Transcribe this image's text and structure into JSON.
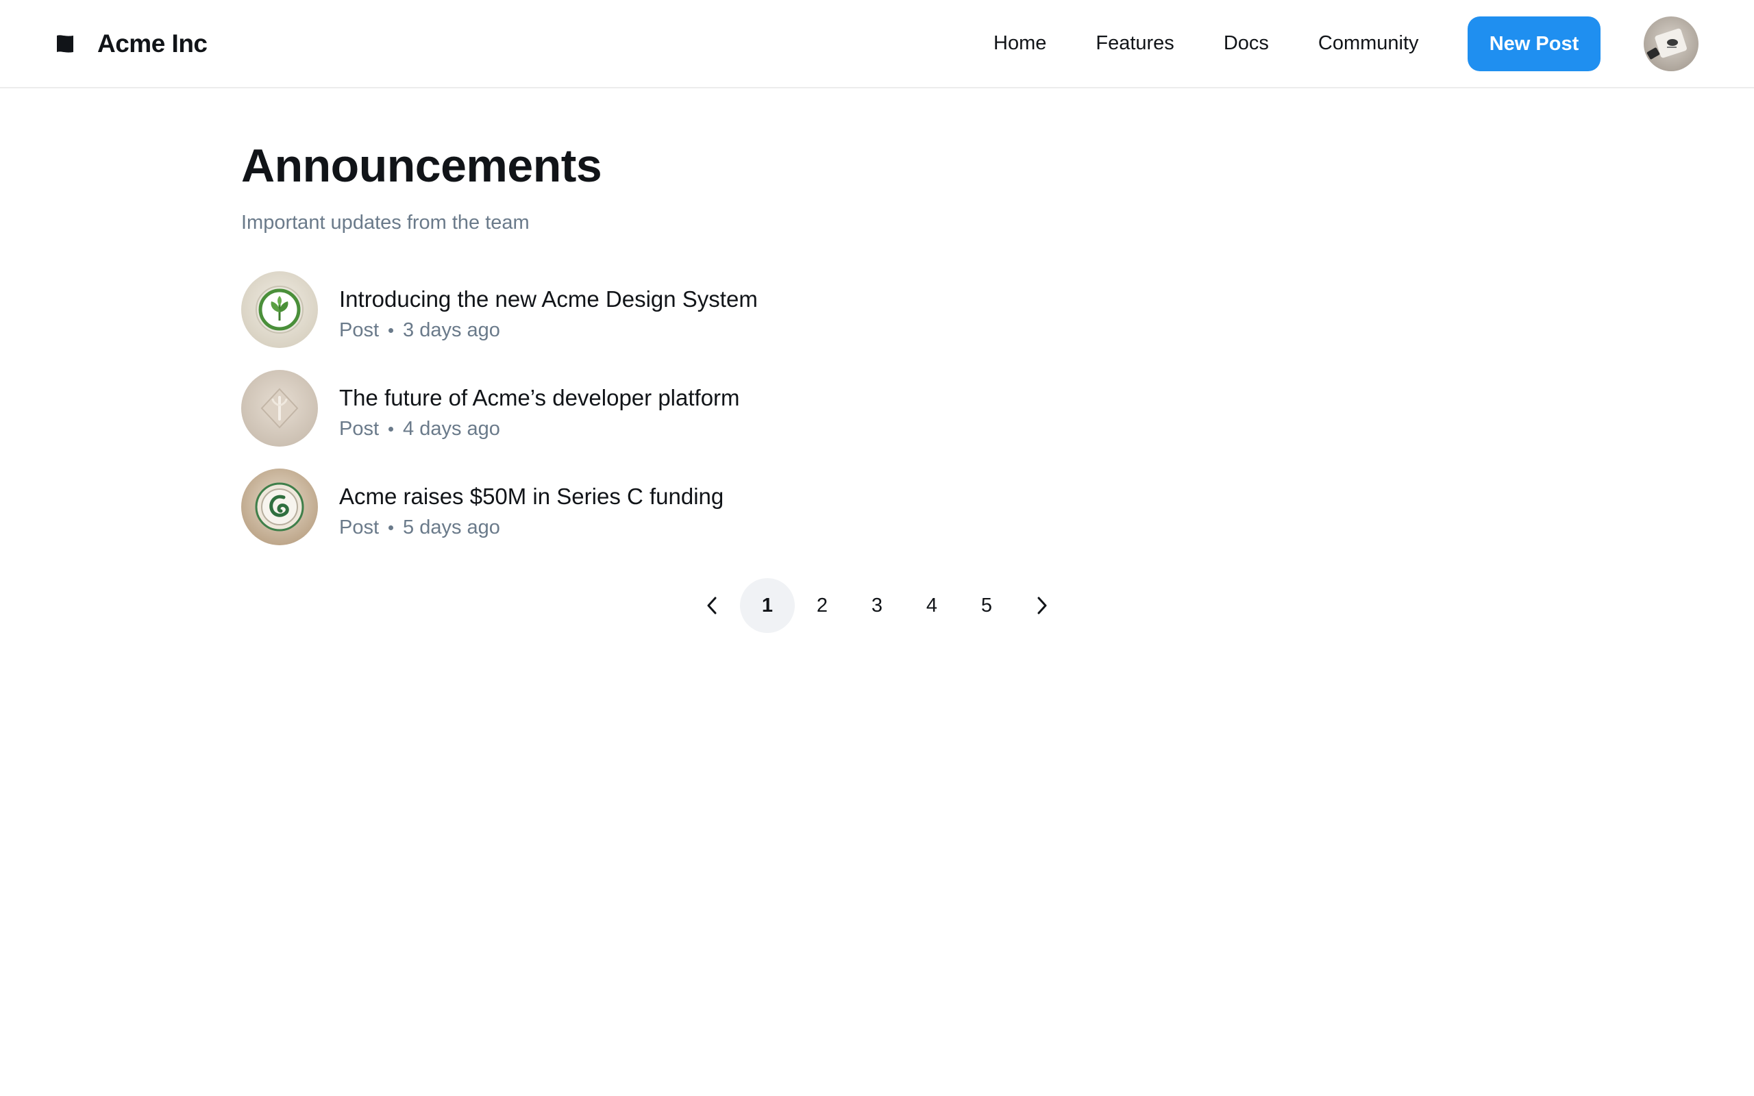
{
  "header": {
    "brand_name": "Acme Inc",
    "logo_icon": "flag-icon",
    "nav": [
      {
        "label": "Home"
      },
      {
        "label": "Features"
      },
      {
        "label": "Docs"
      },
      {
        "label": "Community"
      }
    ],
    "new_post_label": "New Post",
    "accent_color": "#1f8ff0"
  },
  "main": {
    "title": "Announcements",
    "subtitle": "Important updates from the team",
    "items": [
      {
        "title": "Introducing the new Acme Design System",
        "type": "Post",
        "time": "3 days ago",
        "thumb": "leaf-emblem"
      },
      {
        "title": "The future of Acme’s developer platform",
        "type": "Post",
        "time": "4 days ago",
        "thumb": "embossed-emblem"
      },
      {
        "title": "Acme raises $50M in Series C funding",
        "type": "Post",
        "time": "5 days ago",
        "thumb": "swirl-emblem"
      }
    ]
  },
  "pagination": {
    "pages": [
      "1",
      "2",
      "3",
      "4",
      "5"
    ],
    "current": "1",
    "prev_icon": "chevron-left-icon",
    "next_icon": "chevron-right-icon"
  }
}
